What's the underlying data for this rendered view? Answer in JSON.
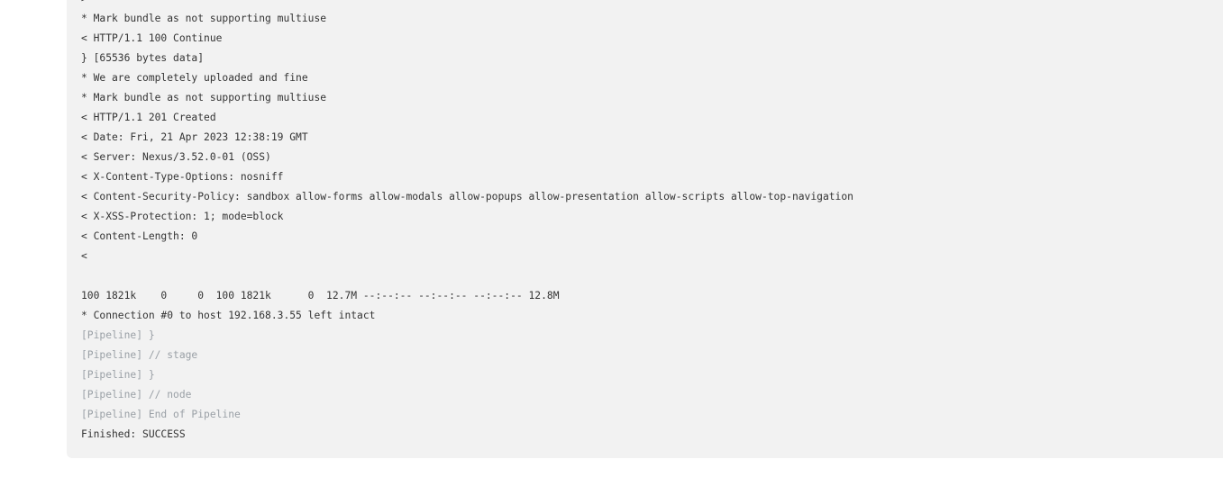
{
  "console": {
    "lines": [
      {
        "text": ">",
        "kind": "normal"
      },
      {
        "text": "* Mark bundle as not supporting multiuse",
        "kind": "normal"
      },
      {
        "text": "< HTTP/1.1 100 Continue",
        "kind": "normal"
      },
      {
        "text": "} [65536 bytes data]",
        "kind": "normal"
      },
      {
        "text": "* We are completely uploaded and fine",
        "kind": "normal"
      },
      {
        "text": "* Mark bundle as not supporting multiuse",
        "kind": "normal"
      },
      {
        "text": "< HTTP/1.1 201 Created",
        "kind": "normal"
      },
      {
        "text": "< Date: Fri, 21 Apr 2023 12:38:19 GMT",
        "kind": "normal"
      },
      {
        "text": "< Server: Nexus/3.52.0-01 (OSS)",
        "kind": "normal"
      },
      {
        "text": "< X-Content-Type-Options: nosniff",
        "kind": "normal"
      },
      {
        "text": "< Content-Security-Policy: sandbox allow-forms allow-modals allow-popups allow-presentation allow-scripts allow-top-navigation",
        "kind": "normal"
      },
      {
        "text": "< X-XSS-Protection: 1; mode=block",
        "kind": "normal"
      },
      {
        "text": "< Content-Length: 0",
        "kind": "normal"
      },
      {
        "text": "<",
        "kind": "normal"
      },
      {
        "text": "",
        "kind": "blank"
      },
      {
        "text": "100 1821k    0     0  100 1821k      0  12.7M --:--:-- --:--:-- --:--:-- 12.8M",
        "kind": "normal"
      },
      {
        "text": "* Connection #0 to host 192.168.3.55 left intact",
        "kind": "normal"
      },
      {
        "text": "[Pipeline] }",
        "kind": "pipeline"
      },
      {
        "text": "[Pipeline] // stage",
        "kind": "pipeline"
      },
      {
        "text": "[Pipeline] }",
        "kind": "pipeline"
      },
      {
        "text": "[Pipeline] // node",
        "kind": "pipeline"
      },
      {
        "text": "[Pipeline] End of Pipeline",
        "kind": "pipeline"
      },
      {
        "text": "Finished: SUCCESS",
        "kind": "normal"
      }
    ]
  },
  "colors": {
    "panel_background": "#f2f2f2",
    "text": "#333333",
    "pipeline_text": "#9aa0a6"
  }
}
